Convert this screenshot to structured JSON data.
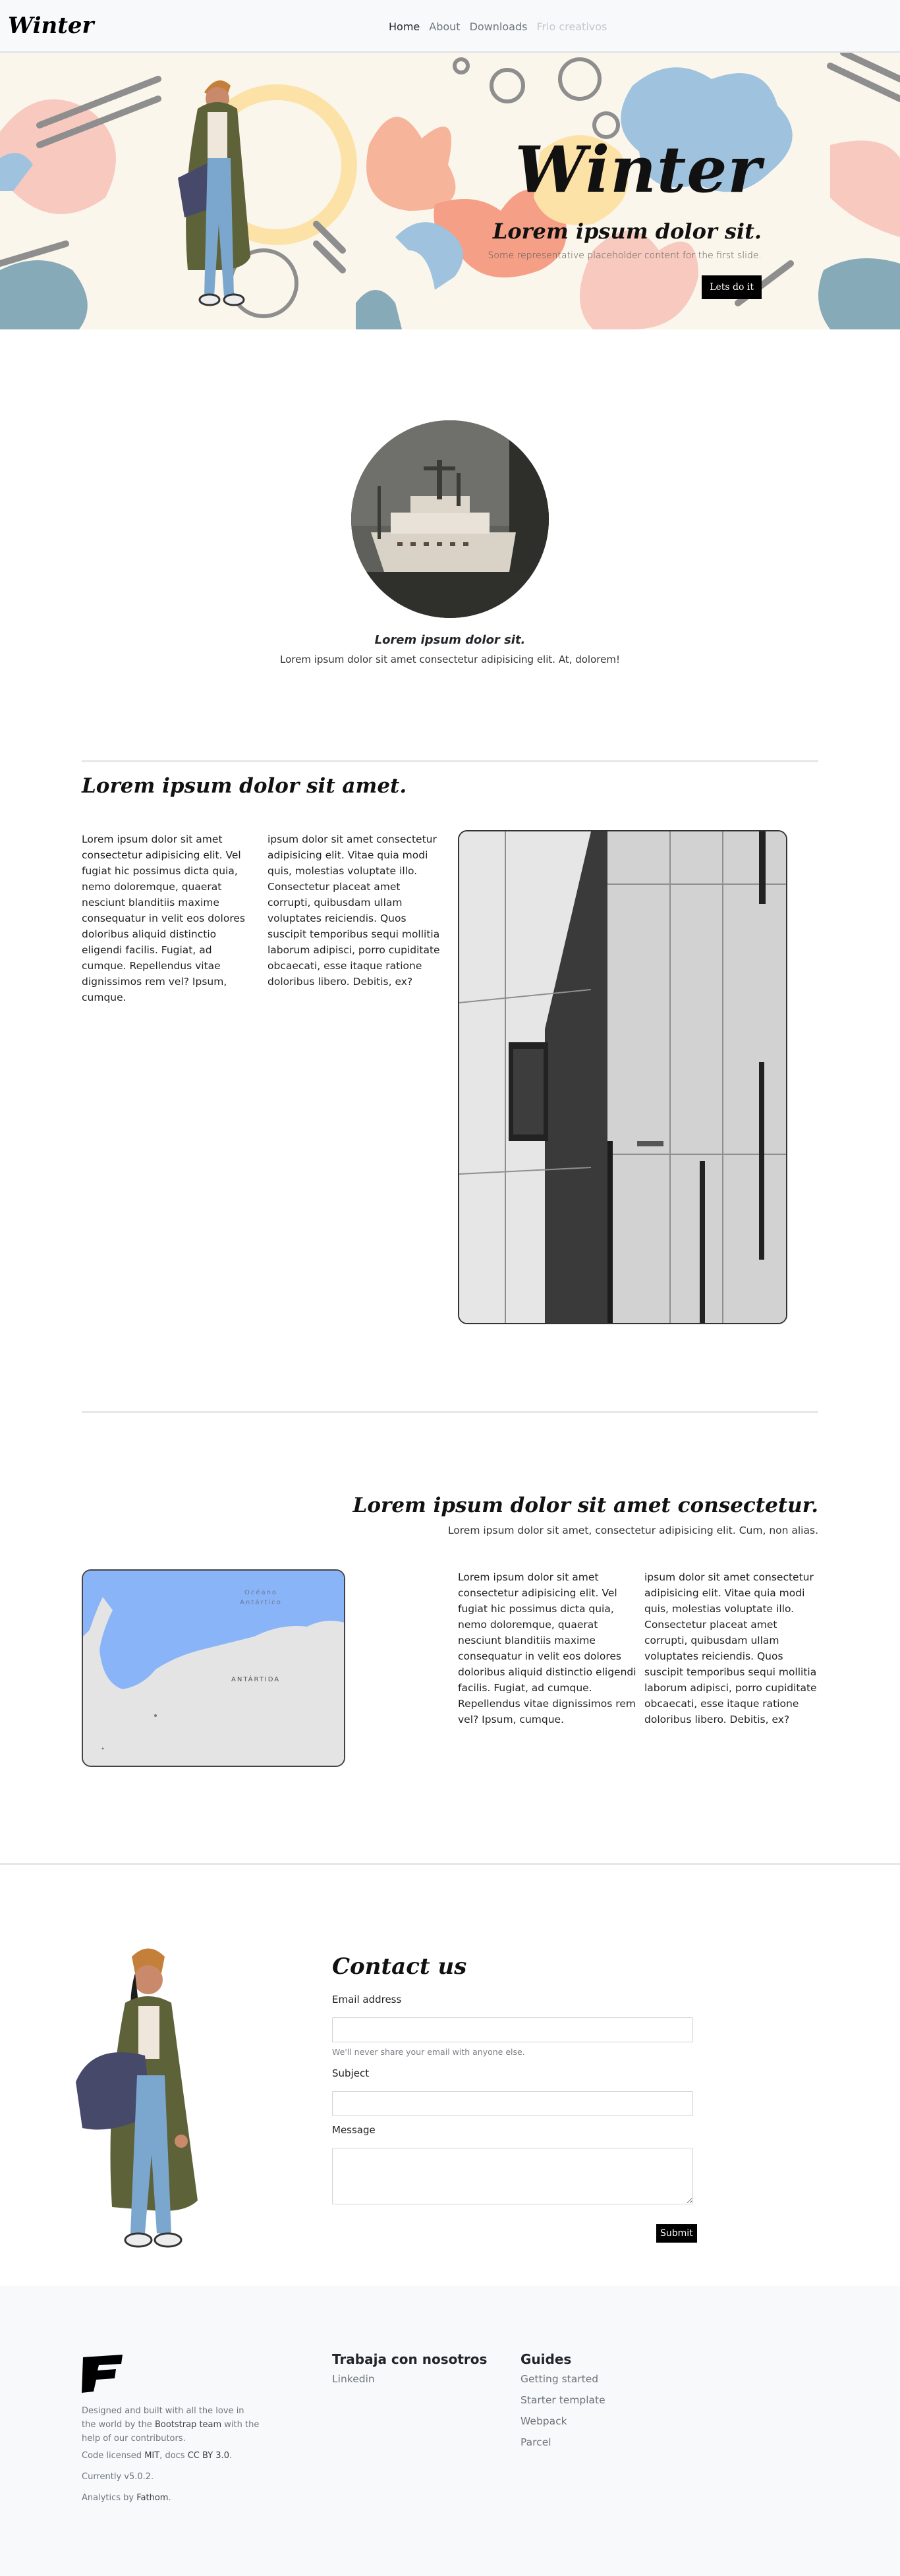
{
  "navbar": {
    "brand": "Winter",
    "links": [
      {
        "label": "Home"
      },
      {
        "label": "About"
      },
      {
        "label": "Downloads"
      },
      {
        "label": "Frio creativos"
      }
    ]
  },
  "hero": {
    "title": "Winter",
    "subtitle": "Lorem ipsum dolor sit.",
    "lead": "Some representative placeholder content for the first slide.",
    "button": "Lets do it"
  },
  "section1": {
    "title": "Lorem ipsum dolor sit.",
    "text": "Lorem ipsum dolor sit amet consectetur adipisicing elit. At, dolorem!"
  },
  "section2": {
    "title": "Lorem ipsum dolor sit amet.",
    "col1": "Lorem ipsum dolor sit amet consectetur adipisicing elit. Vel fugiat hic possimus dicta quia, nemo doloremque, quaerat nesciunt blanditiis maxime consequatur in velit eos dolores doloribus aliquid distinctio eligendi facilis. Fugiat, ad cumque. Repellendus vitae dignissimos rem vel? Ipsum, cumque.",
    "col2": "ipsum dolor sit amet consectetur adipisicing elit. Vitae quia modi quis, molestias voluptate illo. Consectetur placeat amet corrupti, quibusdam ullam voluptates reiciendis. Quos suscipit temporibus sequi mollitia laborum adipisci, porro cupiditate obcaecati, esse itaque ratione doloribus libero. Debitis, ex?"
  },
  "section3": {
    "title": "Lorem ipsum dolor sit amet consectetur.",
    "lead": "Lorem ipsum dolor sit amet, consectetur adipisicing elit. Cum, non alias.",
    "map_ocean": "Océano Antártico",
    "map_land": "ANTÁRTIDA",
    "col1": "Lorem ipsum dolor sit amet consectetur adipisicing elit. Vel fugiat hic possimus dicta quia, nemo doloremque, quaerat nesciunt blanditiis maxime consequatur in velit eos dolores doloribus aliquid distinctio eligendi facilis. Fugiat, ad cumque. Repellendus vitae dignissimos rem vel? Ipsum, cumque.",
    "col2": "ipsum dolor sit amet consectetur adipisicing elit. Vitae quia modi quis, molestias voluptate illo. Consectetur placeat amet corrupti, quibusdam ullam voluptates reiciendis. Quos suscipit temporibus sequi mollitia laborum adipisci, porro cupiditate obcaecati, esse itaque ratione doloribus libero. Debitis, ex?"
  },
  "contact": {
    "title": "Contact us",
    "email_label": "Email address",
    "email_help": "We'll never share your email with anyone else.",
    "subject_label": "Subject",
    "message_label": "Message",
    "submit": "Submit"
  },
  "footer": {
    "desc_1": "Designed and built with all the love in the world by the ",
    "desc_link": "Bootstrap team",
    "desc_2": " with the help of our contributors.",
    "license_1": "Code licensed ",
    "license_mit": "MIT",
    "license_2": ", docs ",
    "license_cc": "CC BY 3.0",
    "license_3": ".",
    "version": "Currently v5.0.2.",
    "analytics_1": "Analytics by ",
    "analytics_link": "Fathom",
    "analytics_2": ".",
    "col2_title": "Trabaja con nosotros",
    "col2_links": [
      "Linkedin"
    ],
    "col3_title": "Guides",
    "col3_links": [
      "Getting started",
      "Starter template",
      "Webpack",
      "Parcel"
    ]
  }
}
